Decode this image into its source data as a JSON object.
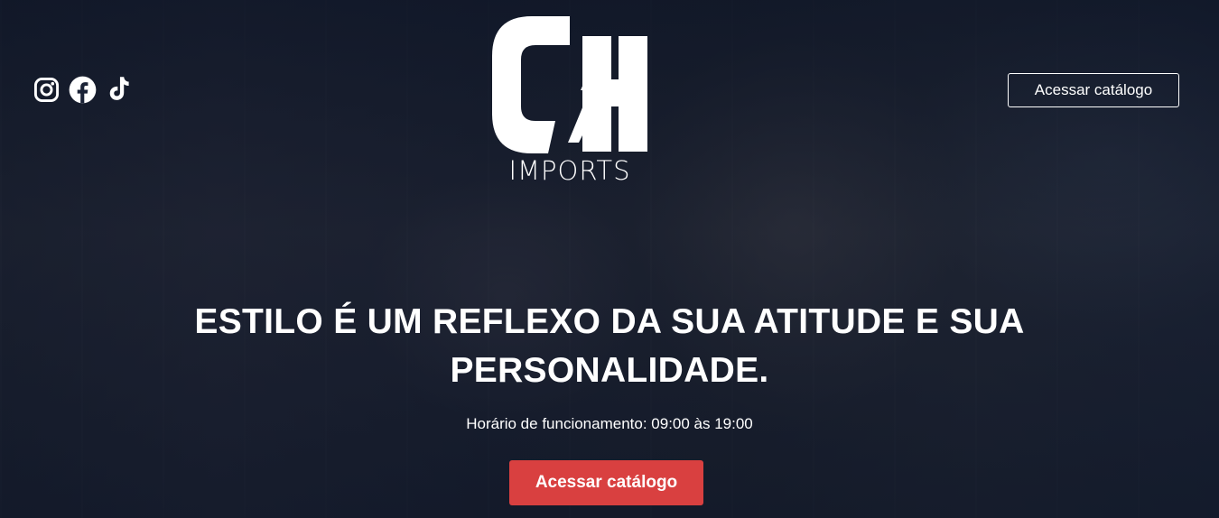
{
  "brand": {
    "logo_letters": "CH",
    "logo_subtitle": "IMPORTS"
  },
  "social": [
    {
      "icon": "instagram-icon"
    },
    {
      "icon": "facebook-icon"
    },
    {
      "icon": "tiktok-icon"
    }
  ],
  "header": {
    "catalog_button_label": "Acessar catálogo"
  },
  "hero": {
    "headline": "ESTILO É UM REFLEXO DA SUA ATITUDE E SUA PERSONALIDADE.",
    "hours": "Horário de funcionamento: 09:00 às 19:00",
    "cta_label": "Acessar catálogo"
  },
  "colors": {
    "overlay": "#0a1224",
    "cta": "#d94040",
    "text": "#ffffff"
  }
}
